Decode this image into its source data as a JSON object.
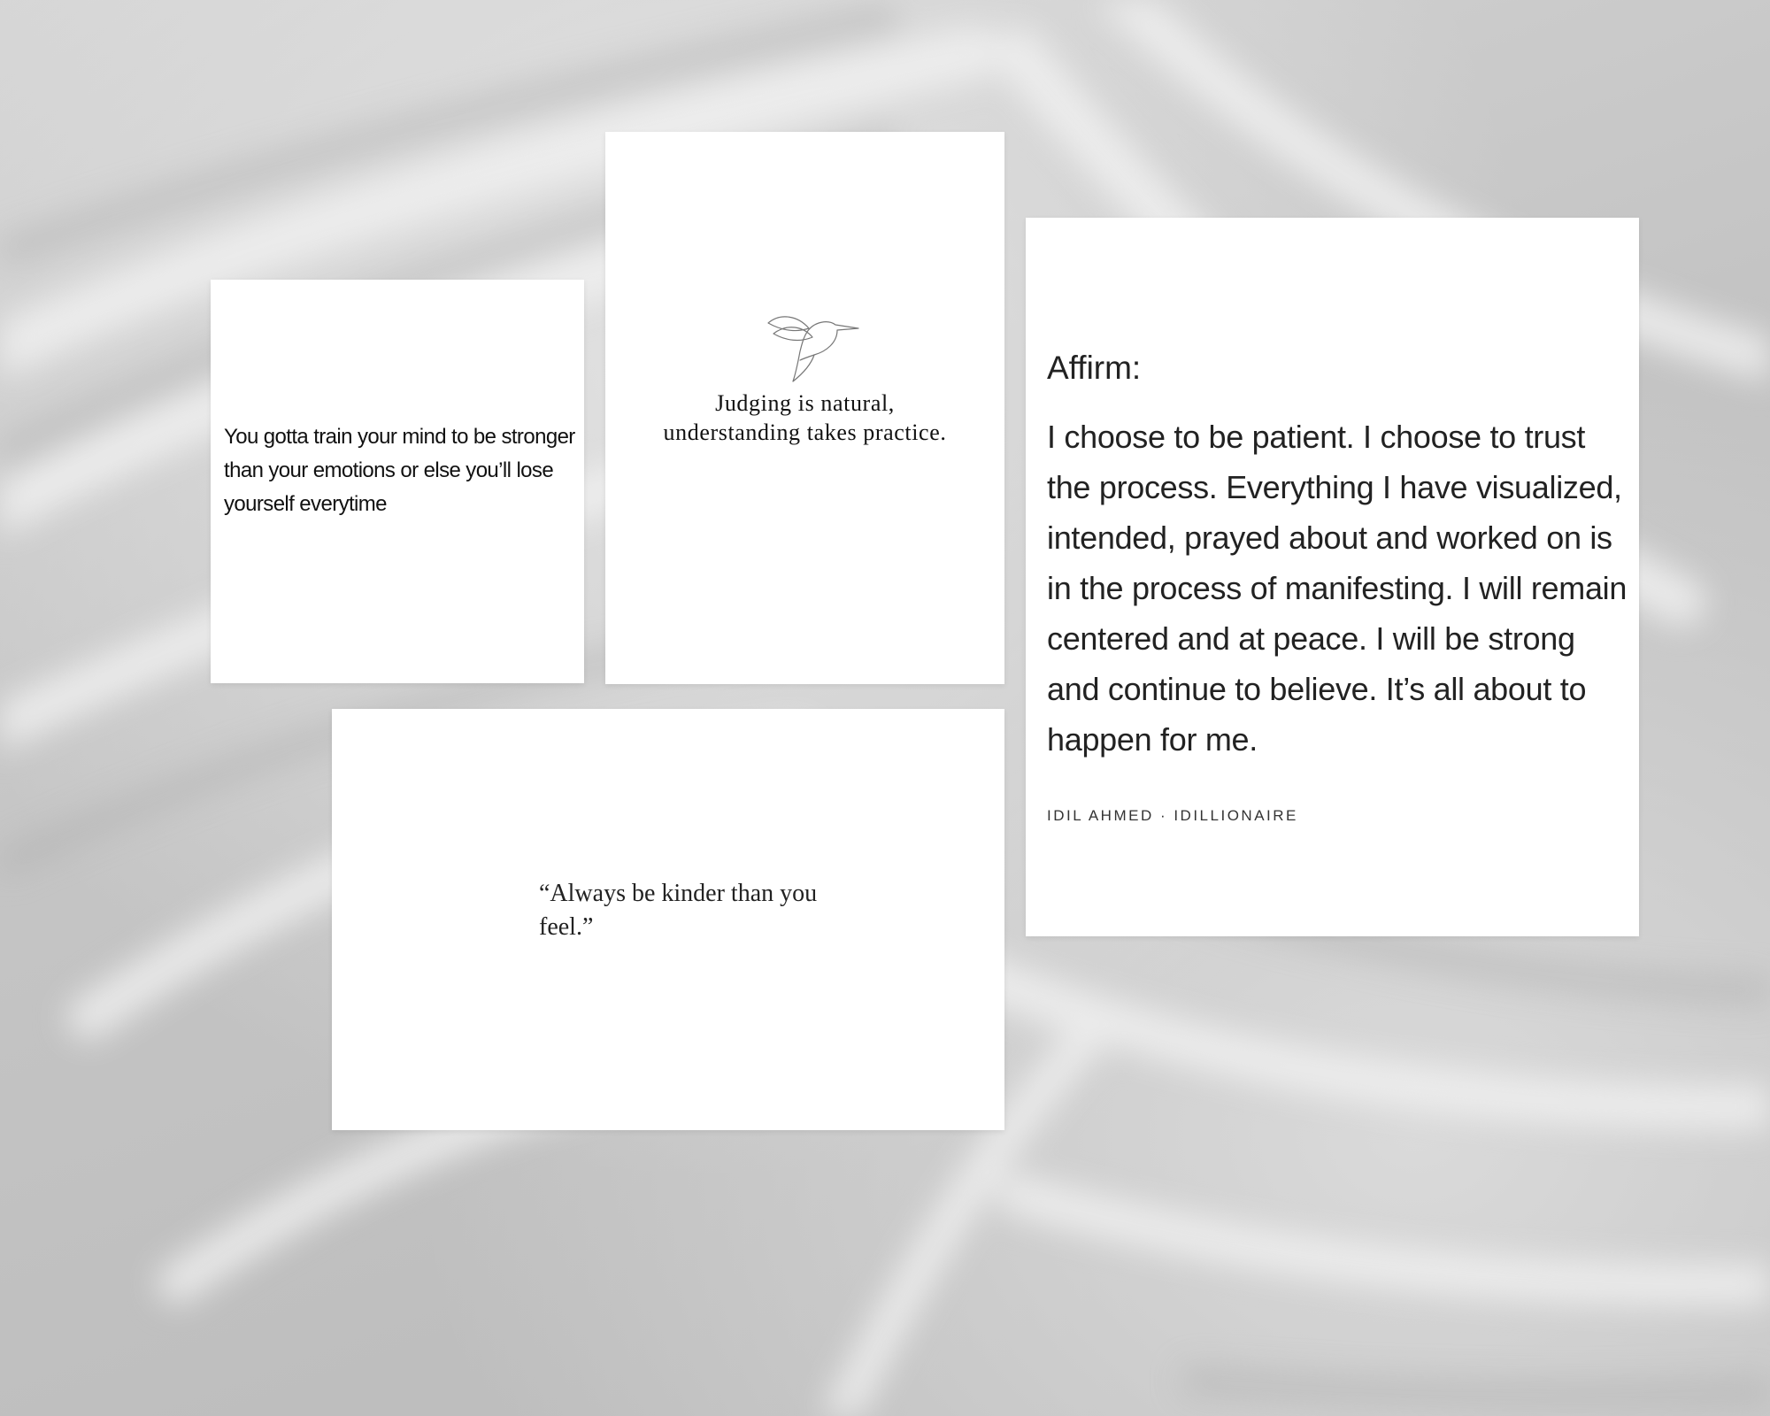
{
  "background": {
    "description_color": "#c9c9c9"
  },
  "cards": {
    "mind": {
      "text": "You gotta train your mind to be stronger than your emotions or else you’ll lose yourself everytime"
    },
    "judging": {
      "icon": "hummingbird-icon",
      "line1": "Judging is natural,",
      "line2": "understanding takes practice."
    },
    "affirm": {
      "heading": "Affirm:",
      "body": "I choose to be patient. I choose to trust the process. Everything I have visualized, intended, prayed about and worked on is in the process of manifesting. I will remain centered and at peace. I will be strong and continue to believe. It’s all about to happen for me.",
      "credit": "IDIL AHMED · IDILLIONAIRE"
    },
    "kinder": {
      "text": "“Always be kinder than you feel.”"
    }
  }
}
